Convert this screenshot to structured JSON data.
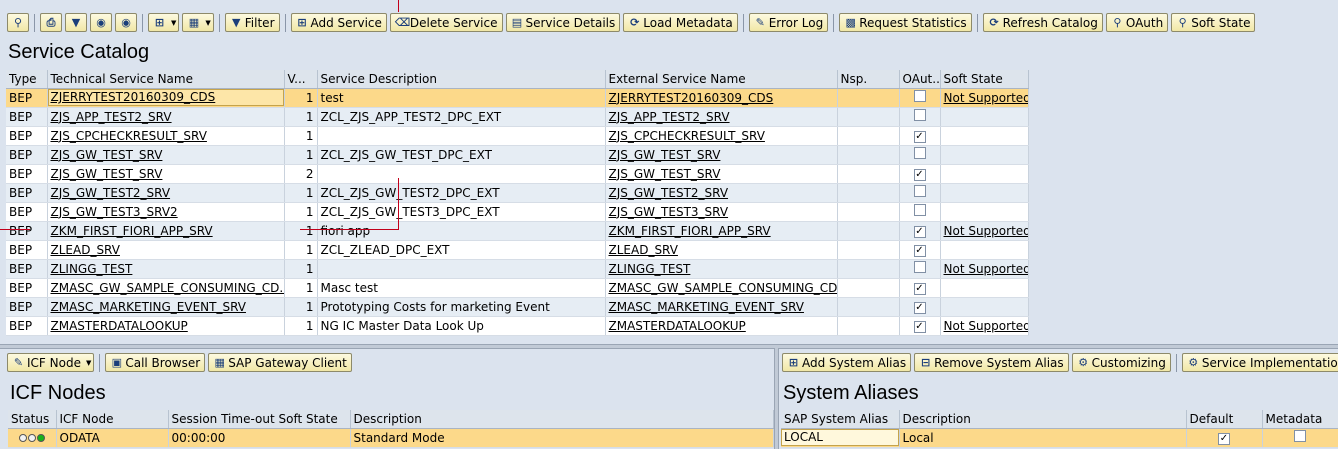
{
  "toolbar": {
    "filter": "Filter",
    "add_service": "Add Service",
    "delete_service": "Delete Service",
    "service_details": "Service Details",
    "load_metadata": "Load Metadata",
    "error_log": "Error Log",
    "request_statistics": "Request Statistics",
    "refresh_catalog": "Refresh Catalog",
    "oauth": "OAuth",
    "soft_state": "Soft State"
  },
  "catalog": {
    "title": "Service Catalog",
    "columns": [
      "Type",
      "Technical Service Name",
      "V...",
      "Service Description",
      "External Service Name",
      "Nsp.",
      "OAut...",
      "Soft State"
    ],
    "rows": [
      {
        "type": "BEP",
        "tech": "ZJERRYTEST20160309_CDS",
        "v": "1",
        "desc": "test",
        "ext": "ZJERRYTEST20160309_CDS",
        "nsp": "",
        "oauth": false,
        "soft": "Not Supported"
      },
      {
        "type": "BEP",
        "tech": "ZJS_APP_TEST2_SRV",
        "v": "1",
        "desc": "ZCL_ZJS_APP_TEST2_DPC_EXT",
        "ext": "ZJS_APP_TEST2_SRV",
        "nsp": "",
        "oauth": false,
        "soft": ""
      },
      {
        "type": "BEP",
        "tech": "ZJS_CPCHECKRESULT_SRV",
        "v": "1",
        "desc": "",
        "ext": "ZJS_CPCHECKRESULT_SRV",
        "nsp": "",
        "oauth": true,
        "soft": ""
      },
      {
        "type": "BEP",
        "tech": "ZJS_GW_TEST_SRV",
        "v": "1",
        "desc": "ZCL_ZJS_GW_TEST_DPC_EXT",
        "ext": "ZJS_GW_TEST_SRV",
        "nsp": "",
        "oauth": false,
        "soft": ""
      },
      {
        "type": "BEP",
        "tech": "ZJS_GW_TEST_SRV",
        "v": "2",
        "desc": "",
        "ext": "ZJS_GW_TEST_SRV",
        "nsp": "",
        "oauth": true,
        "soft": ""
      },
      {
        "type": "BEP",
        "tech": "ZJS_GW_TEST2_SRV",
        "v": "1",
        "desc": "ZCL_ZJS_GW_TEST2_DPC_EXT",
        "ext": "ZJS_GW_TEST2_SRV",
        "nsp": "",
        "oauth": false,
        "soft": ""
      },
      {
        "type": "BEP",
        "tech": "ZJS_GW_TEST3_SRV2",
        "v": "1",
        "desc": "ZCL_ZJS_GW_TEST3_DPC_EXT",
        "ext": "ZJS_GW_TEST3_SRV",
        "nsp": "",
        "oauth": false,
        "soft": ""
      },
      {
        "type": "BEP",
        "tech": "ZKM_FIRST_FIORI_APP_SRV",
        "v": "1",
        "desc": "fiori app",
        "ext": "ZKM_FIRST_FIORI_APP_SRV",
        "nsp": "",
        "oauth": true,
        "soft": "Not Supported"
      },
      {
        "type": "BEP",
        "tech": "ZLEAD_SRV",
        "v": "1",
        "desc": "ZCL_ZLEAD_DPC_EXT",
        "ext": "ZLEAD_SRV",
        "nsp": "",
        "oauth": true,
        "soft": ""
      },
      {
        "type": "BEP",
        "tech": "ZLINGG_TEST",
        "v": "1",
        "desc": "",
        "ext": "ZLINGG_TEST",
        "nsp": "",
        "oauth": false,
        "soft": "Not Supported"
      },
      {
        "type": "BEP",
        "tech": "ZMASC_GW_SAMPLE_CONSUMING_CD...",
        "v": "1",
        "desc": "Masc test",
        "ext": "ZMASC_GW_SAMPLE_CONSUMING_CD...",
        "nsp": "",
        "oauth": true,
        "soft": ""
      },
      {
        "type": "BEP",
        "tech": "ZMASC_MARKETING_EVENT_SRV",
        "v": "1",
        "desc": "Prototyping Costs for marketing Event",
        "ext": "ZMASC_MARKETING_EVENT_SRV",
        "nsp": "",
        "oauth": true,
        "soft": ""
      },
      {
        "type": "BEP",
        "tech": "ZMASTERDATALOOKUP",
        "v": "1",
        "desc": "NG IC Master Data Look Up",
        "ext": "ZMASTERDATALOOKUP",
        "nsp": "",
        "oauth": true,
        "soft": "Not Supported"
      }
    ]
  },
  "icf": {
    "toolbar": {
      "icf_node": "ICF Node",
      "call_browser": "Call Browser",
      "gateway_client": "SAP Gateway Client"
    },
    "title": "ICF Nodes",
    "columns": [
      "Status",
      "ICF Node",
      "Session Time-out Soft State",
      "Description"
    ],
    "rows": [
      {
        "node": "ODATA",
        "timeout": "00:00:00",
        "desc": "Standard Mode"
      }
    ]
  },
  "aliases": {
    "toolbar": {
      "add": "Add System Alias",
      "remove": "Remove System Alias",
      "customizing": "Customizing",
      "impl": "Service Implementation"
    },
    "title": "System Aliases",
    "columns": [
      "SAP System Alias",
      "Description",
      "Default",
      "Metadata"
    ],
    "rows": [
      {
        "alias": "LOCAL",
        "desc": "Local",
        "default": true,
        "metadata": false
      }
    ]
  }
}
